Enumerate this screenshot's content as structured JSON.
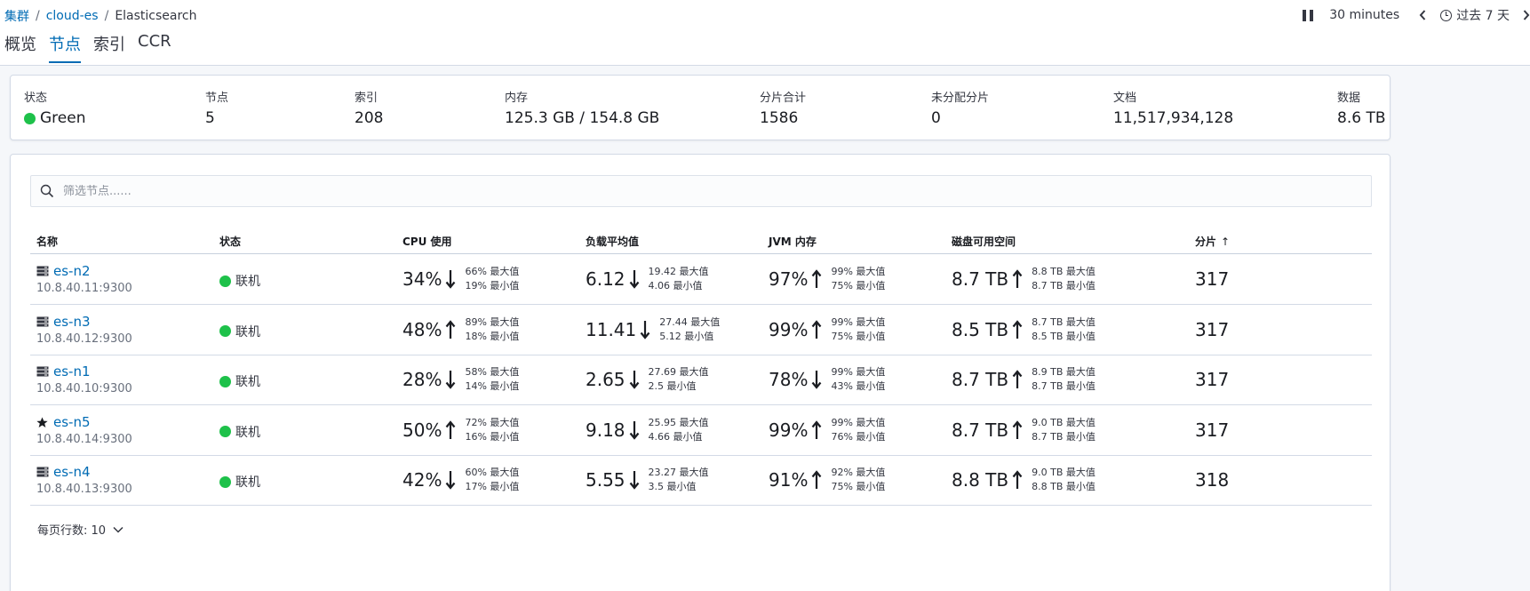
{
  "breadcrumb": [
    {
      "label": "集群"
    },
    {
      "label": "cloud-es"
    },
    {
      "label": "Elasticsearch"
    }
  ],
  "timebar": {
    "interval": "30 minutes",
    "range": "过去 7 天"
  },
  "tabs": [
    {
      "label": "概览",
      "active": false
    },
    {
      "label": "节点",
      "active": true
    },
    {
      "label": "索引",
      "active": false
    },
    {
      "label": "CCR",
      "active": false
    }
  ],
  "stats": {
    "status": {
      "label": "状态",
      "value": "Green"
    },
    "nodes": {
      "label": "节点",
      "value": "5"
    },
    "indices": {
      "label": "索引",
      "value": "208"
    },
    "memory": {
      "label": "内存",
      "value": "125.3 GB / 154.8 GB"
    },
    "total_shards": {
      "label": "分片合计",
      "value": "1586"
    },
    "unassigned_shards": {
      "label": "未分配分片",
      "value": "0"
    },
    "documents": {
      "label": "文档",
      "value": "11,517,934,128"
    },
    "data": {
      "label": "数据",
      "value": "8.6 TB"
    }
  },
  "search": {
    "placeholder": "筛选节点......"
  },
  "table": {
    "headers": {
      "name": "名称",
      "status": "状态",
      "cpu": "CPU 使用",
      "load": "负载平均值",
      "jvm": "JVM 内存",
      "disk": "磁盘可用空间",
      "shards": "分片"
    },
    "rows": [
      {
        "name": "es-n2",
        "address": "10.8.40.11:9300",
        "icon": "server-icon",
        "status": "联机",
        "cpu": {
          "value": "34%",
          "trend": "down",
          "max": "66% 最大值",
          "min": "19% 最小值"
        },
        "load": {
          "value": "6.12",
          "trend": "down",
          "max": "19.42 最大值",
          "min": "4.06 最小值"
        },
        "jvm": {
          "value": "97%",
          "trend": "up",
          "max": "99% 最大值",
          "min": "75% 最小值"
        },
        "disk": {
          "value": "8.7 TB",
          "trend": "up",
          "max": "8.8 TB 最大值",
          "min": "8.7 TB 最小值"
        },
        "shards": "317"
      },
      {
        "name": "es-n3",
        "address": "10.8.40.12:9300",
        "icon": "server-icon",
        "status": "联机",
        "cpu": {
          "value": "48%",
          "trend": "up",
          "max": "89% 最大值",
          "min": "18% 最小值"
        },
        "load": {
          "value": "11.41",
          "trend": "down",
          "max": "27.44 最大值",
          "min": "5.12 最小值"
        },
        "jvm": {
          "value": "99%",
          "trend": "up",
          "max": "99% 最大值",
          "min": "75% 最小值"
        },
        "disk": {
          "value": "8.5 TB",
          "trend": "up",
          "max": "8.7 TB 最大值",
          "min": "8.5 TB 最小值"
        },
        "shards": "317"
      },
      {
        "name": "es-n1",
        "address": "10.8.40.10:9300",
        "icon": "server-icon",
        "status": "联机",
        "cpu": {
          "value": "28%",
          "trend": "down",
          "max": "58% 最大值",
          "min": "14% 最小值"
        },
        "load": {
          "value": "2.65",
          "trend": "down",
          "max": "27.69 最大值",
          "min": "2.5 最小值"
        },
        "jvm": {
          "value": "78%",
          "trend": "down",
          "max": "99% 最大值",
          "min": "43% 最小值"
        },
        "disk": {
          "value": "8.7 TB",
          "trend": "up",
          "max": "8.9 TB 最大值",
          "min": "8.7 TB 最小值"
        },
        "shards": "317"
      },
      {
        "name": "es-n5",
        "address": "10.8.40.14:9300",
        "icon": "star-icon",
        "status": "联机",
        "cpu": {
          "value": "50%",
          "trend": "up",
          "max": "72% 最大值",
          "min": "16% 最小值"
        },
        "load": {
          "value": "9.18",
          "trend": "down",
          "max": "25.95 最大值",
          "min": "4.66 最小值"
        },
        "jvm": {
          "value": "99%",
          "trend": "up",
          "max": "99% 最大值",
          "min": "76% 最小值"
        },
        "disk": {
          "value": "8.7 TB",
          "trend": "up",
          "max": "9.0 TB 最大值",
          "min": "8.7 TB 最小值"
        },
        "shards": "317"
      },
      {
        "name": "es-n4",
        "address": "10.8.40.13:9300",
        "icon": "server-icon",
        "status": "联机",
        "cpu": {
          "value": "42%",
          "trend": "down",
          "max": "60% 最大值",
          "min": "17% 最小值"
        },
        "load": {
          "value": "5.55",
          "trend": "down",
          "max": "23.27 最大值",
          "min": "3.5 最小值"
        },
        "jvm": {
          "value": "91%",
          "trend": "up",
          "max": "92% 最大值",
          "min": "75% 最小值"
        },
        "disk": {
          "value": "8.8 TB",
          "trend": "up",
          "max": "9.0 TB 最大值",
          "min": "8.8 TB 最小值"
        },
        "shards": "318"
      }
    ]
  },
  "pagination": {
    "rows_per_page": "每页行数: 10"
  },
  "colors": {
    "accent": "#006bb4",
    "status_green": "#1ec14a",
    "text": "#343741"
  }
}
